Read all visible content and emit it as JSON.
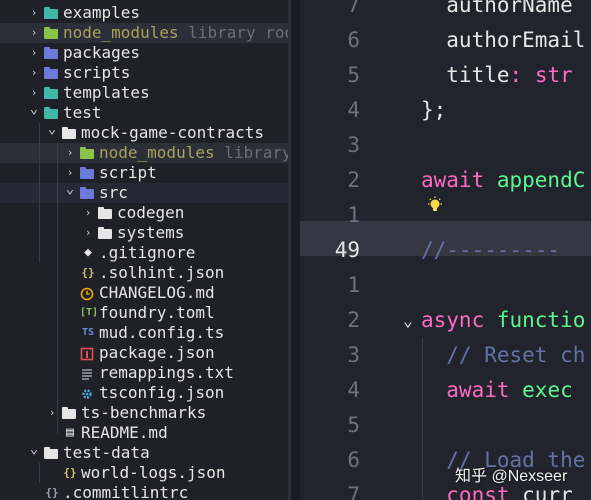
{
  "explorer": {
    "rows": [
      {
        "label": "examples",
        "tag": ""
      },
      {
        "label": "node_modules",
        "tag": "library root"
      },
      {
        "label": "packages",
        "tag": ""
      },
      {
        "label": "scripts",
        "tag": ""
      },
      {
        "label": "templates",
        "tag": ""
      },
      {
        "label": "test",
        "tag": ""
      },
      {
        "label": "mock-game-contracts",
        "tag": ""
      },
      {
        "label": "node_modules",
        "tag": "library r"
      },
      {
        "label": "script",
        "tag": ""
      },
      {
        "label": "src",
        "tag": ""
      },
      {
        "label": "codegen",
        "tag": ""
      },
      {
        "label": "systems",
        "tag": ""
      },
      {
        "label": ".gitignore",
        "tag": ""
      },
      {
        "label": ".solhint.json",
        "tag": ""
      },
      {
        "label": "CHANGELOG.md",
        "tag": ""
      },
      {
        "label": "foundry.toml",
        "tag": ""
      },
      {
        "label": "mud.config.ts",
        "tag": ""
      },
      {
        "label": "package.json",
        "tag": ""
      },
      {
        "label": "remappings.txt",
        "tag": ""
      },
      {
        "label": "tsconfig.json",
        "tag": ""
      },
      {
        "label": "ts-benchmarks",
        "tag": ""
      },
      {
        "label": "README.md",
        "tag": ""
      },
      {
        "label": "test-data",
        "tag": ""
      },
      {
        "label": "world-logs.json",
        "tag": ""
      },
      {
        "label": ".commitlintrc",
        "tag": ""
      }
    ],
    "icon_glyphs": {
      "gitignore": "◆",
      "json": "{}",
      "toml": "[T]",
      "ts": "TS",
      "readme": "▤"
    }
  },
  "editor": {
    "line_numbers": [
      "7",
      "6",
      "5",
      "4",
      "3",
      "2",
      "1",
      "49",
      "1",
      "2",
      "3",
      "4",
      "5",
      "6",
      "7"
    ],
    "lines": [
      {
        "text": "  authorName"
      },
      {
        "prop": "  authorEmail",
        "rest": ""
      },
      {
        "prop": "  title",
        "punct": ": ",
        "type": "str"
      },
      {
        "text": "};"
      },
      {
        "text": ""
      },
      {
        "kw": "await ",
        "fn": "appendC"
      },
      {
        "text": ""
      },
      {
        "cm": "//---------"
      },
      {
        "text": ""
      },
      {
        "kw": "async ",
        "fn": "functio"
      },
      {
        "cm": "  // Reset ch"
      },
      {
        "kw": "  await ",
        "fn": "exec"
      },
      {
        "text": ""
      },
      {
        "cm": "  // Load the"
      },
      {
        "kw": "  const ",
        "pr": "curr"
      }
    ]
  },
  "watermark": "知乎 @Nexseer",
  "colors": {
    "folder": "#8c8f99",
    "folder_teal": "#3fb8a8",
    "folder_blue": "#6c7bd9",
    "node_modules": "#8bc34a",
    "keyword": "#ff6ac1",
    "function": "#5af78e",
    "comment": "#6272a4"
  }
}
